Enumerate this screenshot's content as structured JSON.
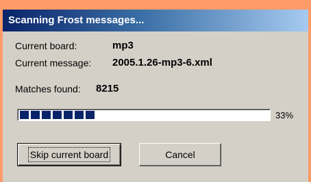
{
  "window": {
    "title": "Scanning Frost messages..."
  },
  "info": {
    "current_board_label": "Current board:",
    "current_board_value": "mp3",
    "current_message_label": "Current message:",
    "current_message_value": "2005.1.26-mp3-6.xml",
    "matches_label": "Matches found:",
    "matches_value": "8215"
  },
  "progress": {
    "percent_text": "33%",
    "fraction": 0.33
  },
  "buttons": {
    "skip_label": "Skip current board",
    "cancel_label": "Cancel"
  },
  "colors": {
    "background_outside": "#ff9b68",
    "dialog_face": "#d4d0c8",
    "title_active": "#0a246a",
    "progress_block": "#0a246a"
  }
}
